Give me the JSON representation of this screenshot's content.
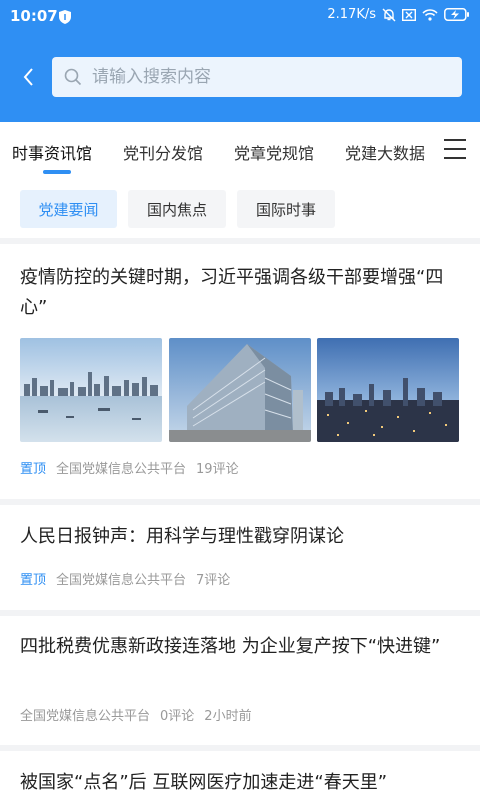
{
  "status_bar": {
    "time": "10:07",
    "network_speed": "2.17K/s"
  },
  "search": {
    "placeholder": "请输入搜索内容"
  },
  "category_tabs": [
    {
      "label": "时事资讯馆",
      "active": true
    },
    {
      "label": "党刊分发馆",
      "active": false
    },
    {
      "label": "党章党规馆",
      "active": false
    },
    {
      "label": "党建大数据",
      "active": false
    }
  ],
  "sub_tabs": [
    {
      "label": "党建要闻",
      "active": true
    },
    {
      "label": "国内焦点",
      "active": false
    },
    {
      "label": "国际时事",
      "active": false
    }
  ],
  "articles": [
    {
      "title": "疫情防控的关键时期，习近平强调各级干部要增强“四心”",
      "pinned_label": "置顶",
      "source": "全国党媒信息公共平台",
      "comments": "19评论"
    },
    {
      "title": "人民日报钟声：用科学与理性戳穿阴谋论",
      "pinned_label": "置顶",
      "source": "全国党媒信息公共平台",
      "comments": "7评论"
    },
    {
      "title": "四批税费优惠新政接连落地 为企业复产按下“快进键”",
      "source": "全国党媒信息公共平台",
      "comments": "0评论",
      "time": "2小时前"
    },
    {
      "title": "被国家“点名”后 互联网医疗加速走进“春天里”"
    }
  ],
  "colors": {
    "primary": "#2f8ff3",
    "background": "#f2f3f5"
  }
}
